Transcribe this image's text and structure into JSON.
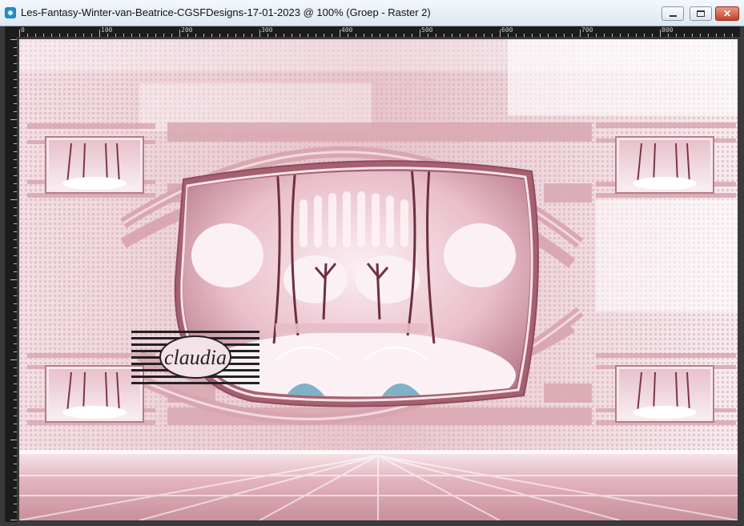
{
  "window": {
    "title": "Les-Fantasy-Winter-van-Beatrice-CGSFDesigns-17-01-2023 @ 100% (Groep - Raster 2)",
    "controls": {
      "minimize": "",
      "maximize": "",
      "close": "✕"
    }
  },
  "ruler": {
    "labels": [
      "0",
      "100",
      "200",
      "300",
      "400",
      "500",
      "600",
      "700",
      "800"
    ]
  },
  "canvas": {
    "watermark": "claudia",
    "colors": {
      "accent": "#c98f9c",
      "frame": "#8e4d5b",
      "sky": "#f6dbe3",
      "dark": "#222222"
    }
  }
}
